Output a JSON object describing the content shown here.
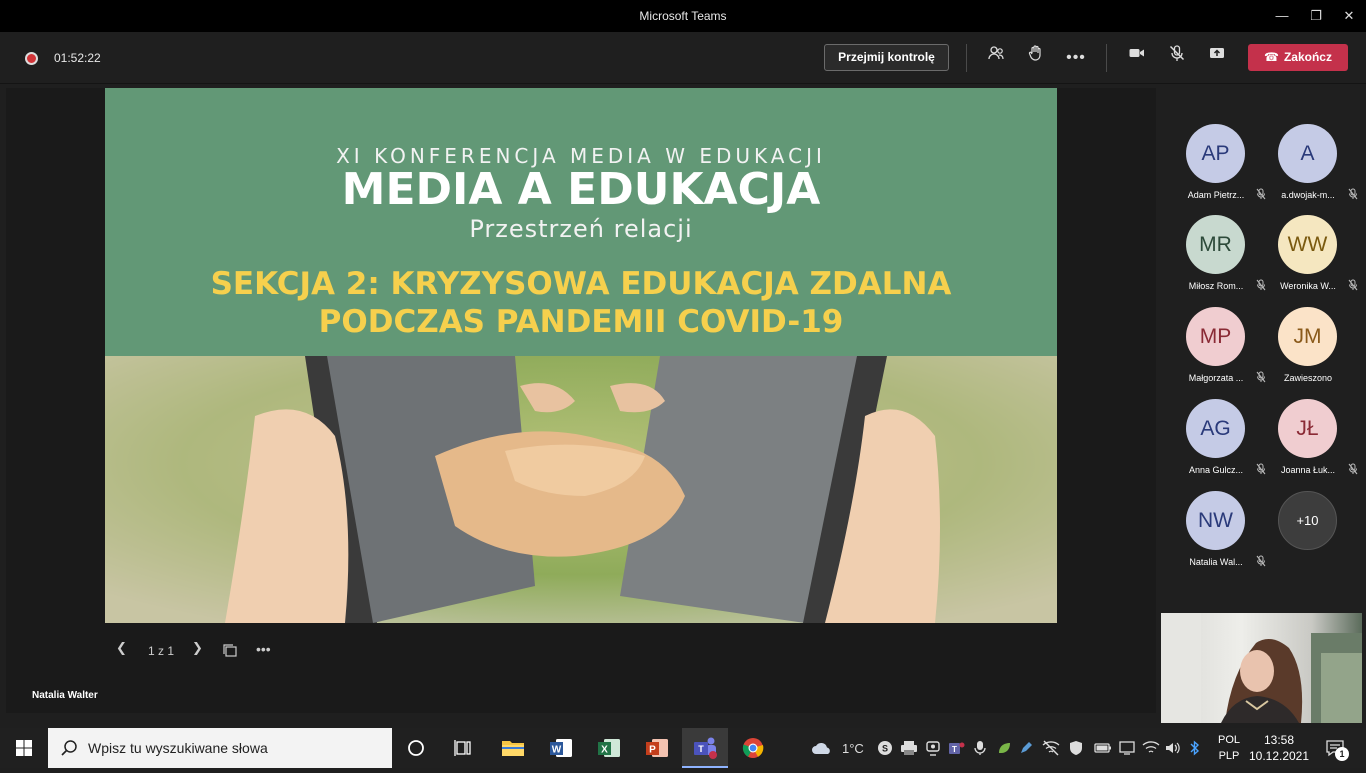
{
  "window": {
    "title": "Microsoft Teams"
  },
  "toolbar": {
    "timer": "01:52:22",
    "take_control_label": "Przejmij kontrolę",
    "end_call_label": "Zakończ"
  },
  "slide": {
    "line1": "XI KONFERENCJA MEDIA W EDUKACJI",
    "line2": "MEDIA A EDUKACJA",
    "line3": "Przestrzeń relacji",
    "line4a": "SEKCJA 2: KRYZYSOWA EDUKACJA ZDALNA",
    "line4b": "PODCZAS PANDEMII COVID-19",
    "page_counter": "1 z 1"
  },
  "presenter_name": "Natalia Walter",
  "participants": [
    {
      "initials": "AP",
      "name": "Adam Pietrz...",
      "bg": "#c5cbe6",
      "fg": "#2a3a7a",
      "muted": true
    },
    {
      "initials": "A",
      "name": "a.dwojak-m...",
      "bg": "#c5cbe6",
      "fg": "#2a3a7a",
      "muted": true
    },
    {
      "initials": "MR",
      "name": "Miłosz Rom...",
      "bg": "#c8d9cf",
      "fg": "#2d4a3a",
      "muted": true
    },
    {
      "initials": "WW",
      "name": "Weronika W...",
      "bg": "#f5e7c0",
      "fg": "#7a5a10",
      "muted": true
    },
    {
      "initials": "MP",
      "name": "Małgorzata ...",
      "bg": "#f0cdd0",
      "fg": "#8a2a35",
      "muted": true
    },
    {
      "initials": "JM",
      "name": "Zawieszono",
      "bg": "#fbe3c8",
      "fg": "#8a5a1a",
      "muted": false
    },
    {
      "initials": "AG",
      "name": "Anna Gulcz...",
      "bg": "#c5cbe6",
      "fg": "#2a3a7a",
      "muted": true
    },
    {
      "initials": "JŁ",
      "name": "Joanna Łuk...",
      "bg": "#f0cdd0",
      "fg": "#8a2a35",
      "muted": true
    },
    {
      "initials": "NW",
      "name": "Natalia Wal...",
      "bg": "#c5cbe6",
      "fg": "#2a3a7a",
      "muted": true
    }
  ],
  "more_participants": "+10",
  "taskbar": {
    "search_placeholder": "Wpisz tu wyszukiwane słowa",
    "weather": "1°C",
    "lang_line1": "POL",
    "lang_line2": "PLP",
    "time": "13:58",
    "date": "10.12.2021",
    "notifications": "1"
  }
}
